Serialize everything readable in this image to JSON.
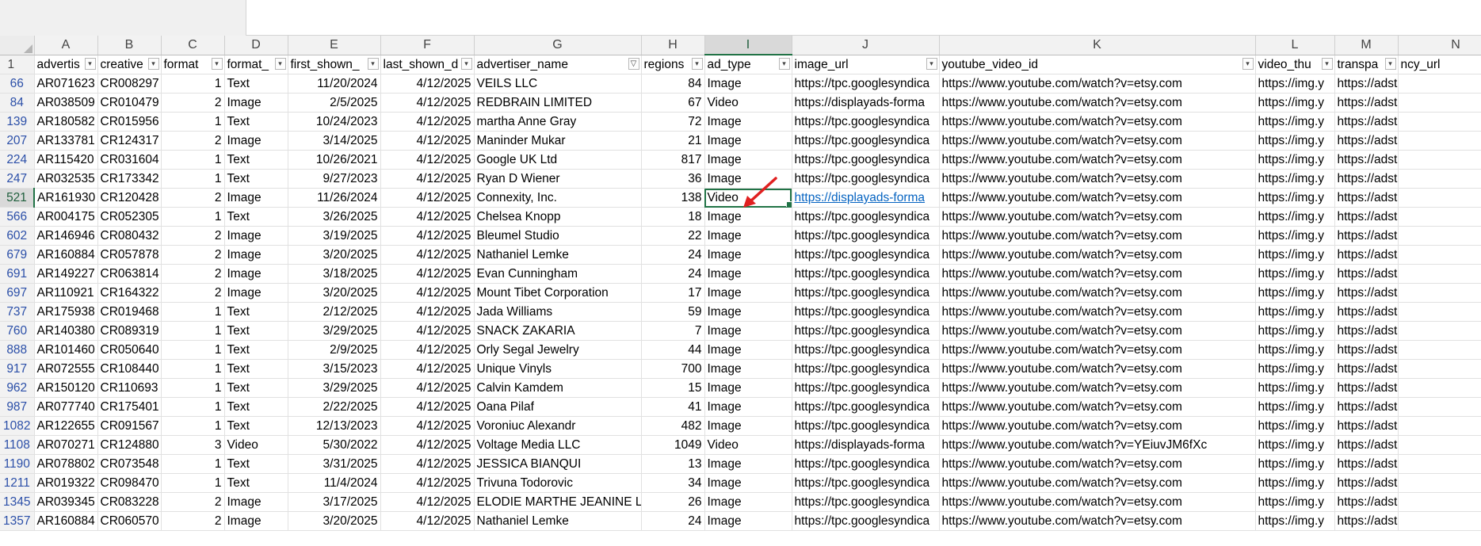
{
  "columns": [
    "A",
    "B",
    "C",
    "D",
    "E",
    "F",
    "G",
    "H",
    "I",
    "J",
    "K",
    "L",
    "M",
    "N"
  ],
  "header_row_number": "1",
  "headers": [
    "advertis",
    "creative",
    "format",
    "format_",
    "first_shown_",
    "last_shown_d",
    "advertiser_name",
    "regions",
    "ad_type",
    "image_url",
    "youtube_video_id",
    "video_thu",
    "transpa",
    "ncy_url"
  ],
  "header_filter_icons": [
    "chevron-down-icon",
    "chevron-down-icon",
    "chevron-down-icon",
    "chevron-down-icon",
    "chevron-down-icon",
    "chevron-down-icon",
    "filter-icon",
    "chevron-down-icon",
    "chevron-down-icon",
    "chevron-down-icon",
    "chevron-down-icon",
    "chevron-down-icon",
    "chevron-down-icon"
  ],
  "rows": [
    {
      "rn": "66",
      "a": "AR071623",
      "b": "CR008297",
      "c": "1",
      "d": "Text",
      "e": "11/20/2024",
      "f": "4/12/2025",
      "g": "VEILS LLC",
      "h": "84",
      "i": "Image",
      "j": "https://tpc.googlesyndica",
      "k": "https://www.youtube.com/watch?v=etsy.com",
      "l": "https://img.y",
      "m": "https://adstransparency.g"
    },
    {
      "rn": "84",
      "a": "AR038509",
      "b": "CR010479",
      "c": "2",
      "d": "Image",
      "e": "2/5/2025",
      "f": "4/12/2025",
      "g": "REDBRAIN LIMITED",
      "h": "67",
      "i": "Video",
      "j": "https://displayads-forma",
      "k": "https://www.youtube.com/watch?v=etsy.com",
      "l": "https://img.y",
      "m": "https://adstransparency.g"
    },
    {
      "rn": "139",
      "a": "AR180582",
      "b": "CR015956",
      "c": "1",
      "d": "Text",
      "e": "10/24/2023",
      "f": "4/12/2025",
      "g": "martha Anne Gray",
      "h": "72",
      "i": "Image",
      "j": "https://tpc.googlesyndica",
      "k": "https://www.youtube.com/watch?v=etsy.com",
      "l": "https://img.y",
      "m": "https://adstransparency.g"
    },
    {
      "rn": "207",
      "a": "AR133781",
      "b": "CR124317",
      "c": "2",
      "d": "Image",
      "e": "3/14/2025",
      "f": "4/12/2025",
      "g": "Maninder Mukar",
      "h": "21",
      "i": "Image",
      "j": "https://tpc.googlesyndica",
      "k": "https://www.youtube.com/watch?v=etsy.com",
      "l": "https://img.y",
      "m": "https://adstransparency.g"
    },
    {
      "rn": "224",
      "a": "AR115420",
      "b": "CR031604",
      "c": "1",
      "d": "Text",
      "e": "10/26/2021",
      "f": "4/12/2025",
      "g": "Google UK Ltd",
      "h": "817",
      "i": "Image",
      "j": "https://tpc.googlesyndica",
      "k": "https://www.youtube.com/watch?v=etsy.com",
      "l": "https://img.y",
      "m": "https://adstransparency.g"
    },
    {
      "rn": "247",
      "a": "AR032535",
      "b": "CR173342",
      "c": "1",
      "d": "Text",
      "e": "9/27/2023",
      "f": "4/12/2025",
      "g": "Ryan D Wiener",
      "h": "36",
      "i": "Image",
      "j": "https://tpc.googlesyndica",
      "k": "https://www.youtube.com/watch?v=etsy.com",
      "l": "https://img.y",
      "m": "https://adstransparency.g"
    },
    {
      "rn": "521",
      "a": "AR161930",
      "b": "CR120428",
      "c": "2",
      "d": "Image",
      "e": "11/26/2024",
      "f": "4/12/2025",
      "g": "Connexity, Inc.",
      "h": "138",
      "i": "Video",
      "j": "https://displayads-forma",
      "k": "https://www.youtube.com/watch?v=etsy.com",
      "l": "https://img.y",
      "m": "https://adstransparency.g"
    },
    {
      "rn": "566",
      "a": "AR004175",
      "b": "CR052305",
      "c": "1",
      "d": "Text",
      "e": "3/26/2025",
      "f": "4/12/2025",
      "g": "Chelsea Knopp",
      "h": "18",
      "i": "Image",
      "j": "https://tpc.googlesyndica",
      "k": "https://www.youtube.com/watch?v=etsy.com",
      "l": "https://img.y",
      "m": "https://adstransparency.g"
    },
    {
      "rn": "602",
      "a": "AR146946",
      "b": "CR080432",
      "c": "2",
      "d": "Image",
      "e": "3/19/2025",
      "f": "4/12/2025",
      "g": "Bleumel Studio",
      "h": "22",
      "i": "Image",
      "j": "https://tpc.googlesyndica",
      "k": "https://www.youtube.com/watch?v=etsy.com",
      "l": "https://img.y",
      "m": "https://adstransparency.g"
    },
    {
      "rn": "679",
      "a": "AR160884",
      "b": "CR057878",
      "c": "2",
      "d": "Image",
      "e": "3/20/2025",
      "f": "4/12/2025",
      "g": "Nathaniel Lemke",
      "h": "24",
      "i": "Image",
      "j": "https://tpc.googlesyndica",
      "k": "https://www.youtube.com/watch?v=etsy.com",
      "l": "https://img.y",
      "m": "https://adstransparency.g"
    },
    {
      "rn": "691",
      "a": "AR149227",
      "b": "CR063814",
      "c": "2",
      "d": "Image",
      "e": "3/18/2025",
      "f": "4/12/2025",
      "g": "Evan Cunningham",
      "h": "24",
      "i": "Image",
      "j": "https://tpc.googlesyndica",
      "k": "https://www.youtube.com/watch?v=etsy.com",
      "l": "https://img.y",
      "m": "https://adstransparency.g"
    },
    {
      "rn": "697",
      "a": "AR110921",
      "b": "CR164322",
      "c": "2",
      "d": "Image",
      "e": "3/20/2025",
      "f": "4/12/2025",
      "g": "Mount Tibet Corporation",
      "h": "17",
      "i": "Image",
      "j": "https://tpc.googlesyndica",
      "k": "https://www.youtube.com/watch?v=etsy.com",
      "l": "https://img.y",
      "m": "https://adstransparency.g"
    },
    {
      "rn": "737",
      "a": "AR175938",
      "b": "CR019468",
      "c": "1",
      "d": "Text",
      "e": "2/12/2025",
      "f": "4/12/2025",
      "g": "Jada Williams",
      "h": "59",
      "i": "Image",
      "j": "https://tpc.googlesyndica",
      "k": "https://www.youtube.com/watch?v=etsy.com",
      "l": "https://img.y",
      "m": "https://adstransparency.g"
    },
    {
      "rn": "760",
      "a": "AR140380",
      "b": "CR089319",
      "c": "1",
      "d": "Text",
      "e": "3/29/2025",
      "f": "4/12/2025",
      "g": "SNACK ZAKARIA",
      "h": "7",
      "i": "Image",
      "j": "https://tpc.googlesyndica",
      "k": "https://www.youtube.com/watch?v=etsy.com",
      "l": "https://img.y",
      "m": "https://adstransparency.g"
    },
    {
      "rn": "888",
      "a": "AR101460",
      "b": "CR050640",
      "c": "1",
      "d": "Text",
      "e": "2/9/2025",
      "f": "4/12/2025",
      "g": "Orly Segal Jewelry",
      "h": "44",
      "i": "Image",
      "j": "https://tpc.googlesyndica",
      "k": "https://www.youtube.com/watch?v=etsy.com",
      "l": "https://img.y",
      "m": "https://adstransparency.g"
    },
    {
      "rn": "917",
      "a": "AR072555",
      "b": "CR108440",
      "c": "1",
      "d": "Text",
      "e": "3/15/2023",
      "f": "4/12/2025",
      "g": "Unique Vinyls",
      "h": "700",
      "i": "Image",
      "j": "https://tpc.googlesyndica",
      "k": "https://www.youtube.com/watch?v=etsy.com",
      "l": "https://img.y",
      "m": "https://adstransparency.g"
    },
    {
      "rn": "962",
      "a": "AR150120",
      "b": "CR110693",
      "c": "1",
      "d": "Text",
      "e": "3/29/2025",
      "f": "4/12/2025",
      "g": "Calvin Kamdem",
      "h": "15",
      "i": "Image",
      "j": "https://tpc.googlesyndica",
      "k": "https://www.youtube.com/watch?v=etsy.com",
      "l": "https://img.y",
      "m": "https://adstransparency.g"
    },
    {
      "rn": "987",
      "a": "AR077740",
      "b": "CR175401",
      "c": "1",
      "d": "Text",
      "e": "2/22/2025",
      "f": "4/12/2025",
      "g": "Oana Pilaf",
      "h": "41",
      "i": "Image",
      "j": "https://tpc.googlesyndica",
      "k": "https://www.youtube.com/watch?v=etsy.com",
      "l": "https://img.y",
      "m": "https://adstransparency.g"
    },
    {
      "rn": "1082",
      "a": "AR122655",
      "b": "CR091567",
      "c": "1",
      "d": "Text",
      "e": "12/13/2023",
      "f": "4/12/2025",
      "g": "Voroniuc Alexandr",
      "h": "482",
      "i": "Image",
      "j": "https://tpc.googlesyndica",
      "k": "https://www.youtube.com/watch?v=etsy.com",
      "l": "https://img.y",
      "m": "https://adstransparency.g"
    },
    {
      "rn": "1108",
      "a": "AR070271",
      "b": "CR124880",
      "c": "3",
      "d": "Video",
      "e": "5/30/2022",
      "f": "4/12/2025",
      "g": "Voltage Media LLC",
      "h": "1049",
      "i": "Video",
      "j": "https://displayads-forma",
      "k": "https://www.youtube.com/watch?v=YEiuvJM6fXc",
      "l": "https://img.y",
      "m": "https://adstransparency.g"
    },
    {
      "rn": "1190",
      "a": "AR078802",
      "b": "CR073548",
      "c": "1",
      "d": "Text",
      "e": "3/31/2025",
      "f": "4/12/2025",
      "g": "JESSICA BIANQUI",
      "h": "13",
      "i": "Image",
      "j": "https://tpc.googlesyndica",
      "k": "https://www.youtube.com/watch?v=etsy.com",
      "l": "https://img.y",
      "m": "https://adstransparency.g"
    },
    {
      "rn": "1211",
      "a": "AR019322",
      "b": "CR098470",
      "c": "1",
      "d": "Text",
      "e": "11/4/2024",
      "f": "4/12/2025",
      "g": "Trivuna Todorovic",
      "h": "34",
      "i": "Image",
      "j": "https://tpc.googlesyndica",
      "k": "https://www.youtube.com/watch?v=etsy.com",
      "l": "https://img.y",
      "m": "https://adstransparency.g"
    },
    {
      "rn": "1345",
      "a": "AR039345",
      "b": "CR083228",
      "c": "2",
      "d": "Image",
      "e": "3/17/2025",
      "f": "4/12/2025",
      "g": "ELODIE MARTHE JEANINE LC",
      "h": "26",
      "i": "Image",
      "j": "https://tpc.googlesyndica",
      "k": "https://www.youtube.com/watch?v=etsy.com",
      "l": "https://img.y",
      "m": "https://adstransparency.g"
    },
    {
      "rn": "1357",
      "a": "AR160884",
      "b": "CR060570",
      "c": "2",
      "d": "Image",
      "e": "3/20/2025",
      "f": "4/12/2025",
      "g": "Nathaniel Lemke",
      "h": "24",
      "i": "Image",
      "j": "https://tpc.googlesyndica",
      "k": "https://www.youtube.com/watch?v=etsy.com",
      "l": "https://img.y",
      "m": "https://adstransparency.g"
    }
  ],
  "active_cell": {
    "row_number": "521",
    "column": "I"
  },
  "colors": {
    "selection": "#217346",
    "link": "#0563c1",
    "arrow": "#e02020",
    "row_number": "#2b4fa8"
  }
}
